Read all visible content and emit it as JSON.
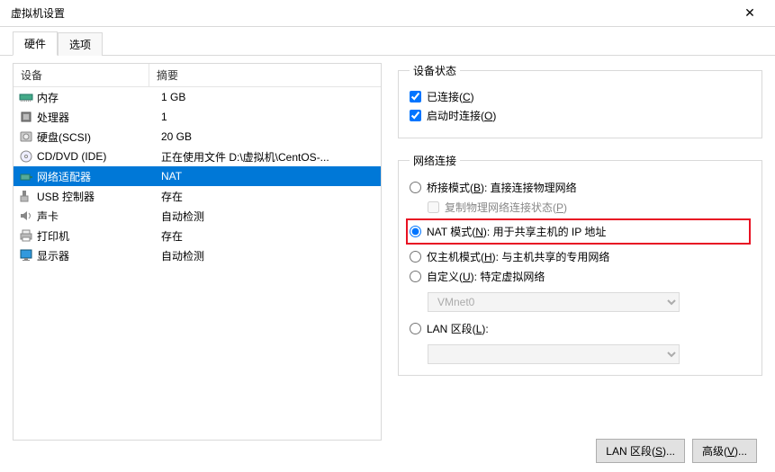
{
  "window_title": "虚拟机设置",
  "tabs": {
    "hardware": "硬件",
    "options": "选项"
  },
  "list_header": {
    "device": "设备",
    "summary": "摘要"
  },
  "devices": [
    {
      "icon": "memory",
      "name": "内存",
      "summary": "1 GB"
    },
    {
      "icon": "cpu",
      "name": "处理器",
      "summary": "1"
    },
    {
      "icon": "disk",
      "name": "硬盘(SCSI)",
      "summary": "20 GB"
    },
    {
      "icon": "cd",
      "name": "CD/DVD (IDE)",
      "summary": "正在使用文件 D:\\虚拟机\\CentOS-..."
    },
    {
      "icon": "net",
      "name": "网络适配器",
      "summary": "NAT",
      "selected": true
    },
    {
      "icon": "usb",
      "name": "USB 控制器",
      "summary": "存在"
    },
    {
      "icon": "sound",
      "name": "声卡",
      "summary": "自动检测"
    },
    {
      "icon": "printer",
      "name": "打印机",
      "summary": "存在"
    },
    {
      "icon": "display",
      "name": "显示器",
      "summary": "自动检测"
    }
  ],
  "device_state": {
    "legend": "设备状态",
    "connected": "已连接(",
    "connected_u": "C",
    "connected_end": ")",
    "connect_on": "启动时连接(",
    "connect_on_u": "O",
    "connect_on_end": ")"
  },
  "net_conn": {
    "legend": "网络连接",
    "bridged": "桥接模式(",
    "bridged_u": "B",
    "bridged_end": "): 直接连接物理网络",
    "replicate": "复制物理网络连接状态(",
    "replicate_u": "P",
    "replicate_end": ")",
    "nat": "NAT 模式(",
    "nat_u": "N",
    "nat_end": "): 用于共享主机的 IP 地址",
    "hostonly": "仅主机模式(",
    "hostonly_u": "H",
    "hostonly_end": "): 与主机共享的专用网络",
    "custom": "自定义(",
    "custom_u": "U",
    "custom_end": "): 特定虚拟网络",
    "vmnet_option": "VMnet0",
    "lan": "LAN 区段(",
    "lan_u": "L",
    "lan_end": "):"
  },
  "buttons": {
    "lan_seg": "LAN 区段(",
    "lan_seg_u": "S",
    "lan_seg_end": ")...",
    "advanced": "高级(",
    "advanced_u": "V",
    "advanced_end": ")..."
  }
}
